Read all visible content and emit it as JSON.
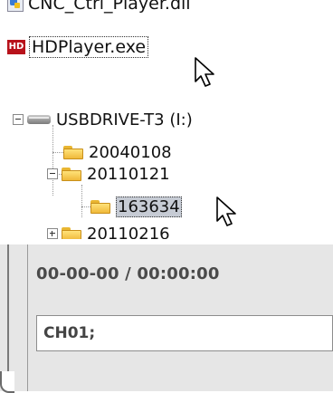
{
  "file_list": {
    "items": [
      {
        "label": "CNC_Ctrl_Player.dll",
        "icon": "dll-file-icon"
      },
      {
        "label": "HDPlayer.exe",
        "icon": "hd-app-icon",
        "selected": true
      }
    ]
  },
  "tree": {
    "drive_label": "USBDRIVE-T3 (I:)",
    "folders": [
      {
        "label": "20040108"
      },
      {
        "label": "20110121",
        "children": [
          {
            "label": "163634",
            "selected": true
          }
        ]
      },
      {
        "label": "20110216"
      }
    ]
  },
  "player": {
    "time_display": "00-00-00 / 00:00:00",
    "channel_field": "CH01;"
  },
  "colors": {
    "selection_bg": "#c6cbd4",
    "panel_bg": "#e6e6e6",
    "hd_icon": "#b8121b"
  }
}
